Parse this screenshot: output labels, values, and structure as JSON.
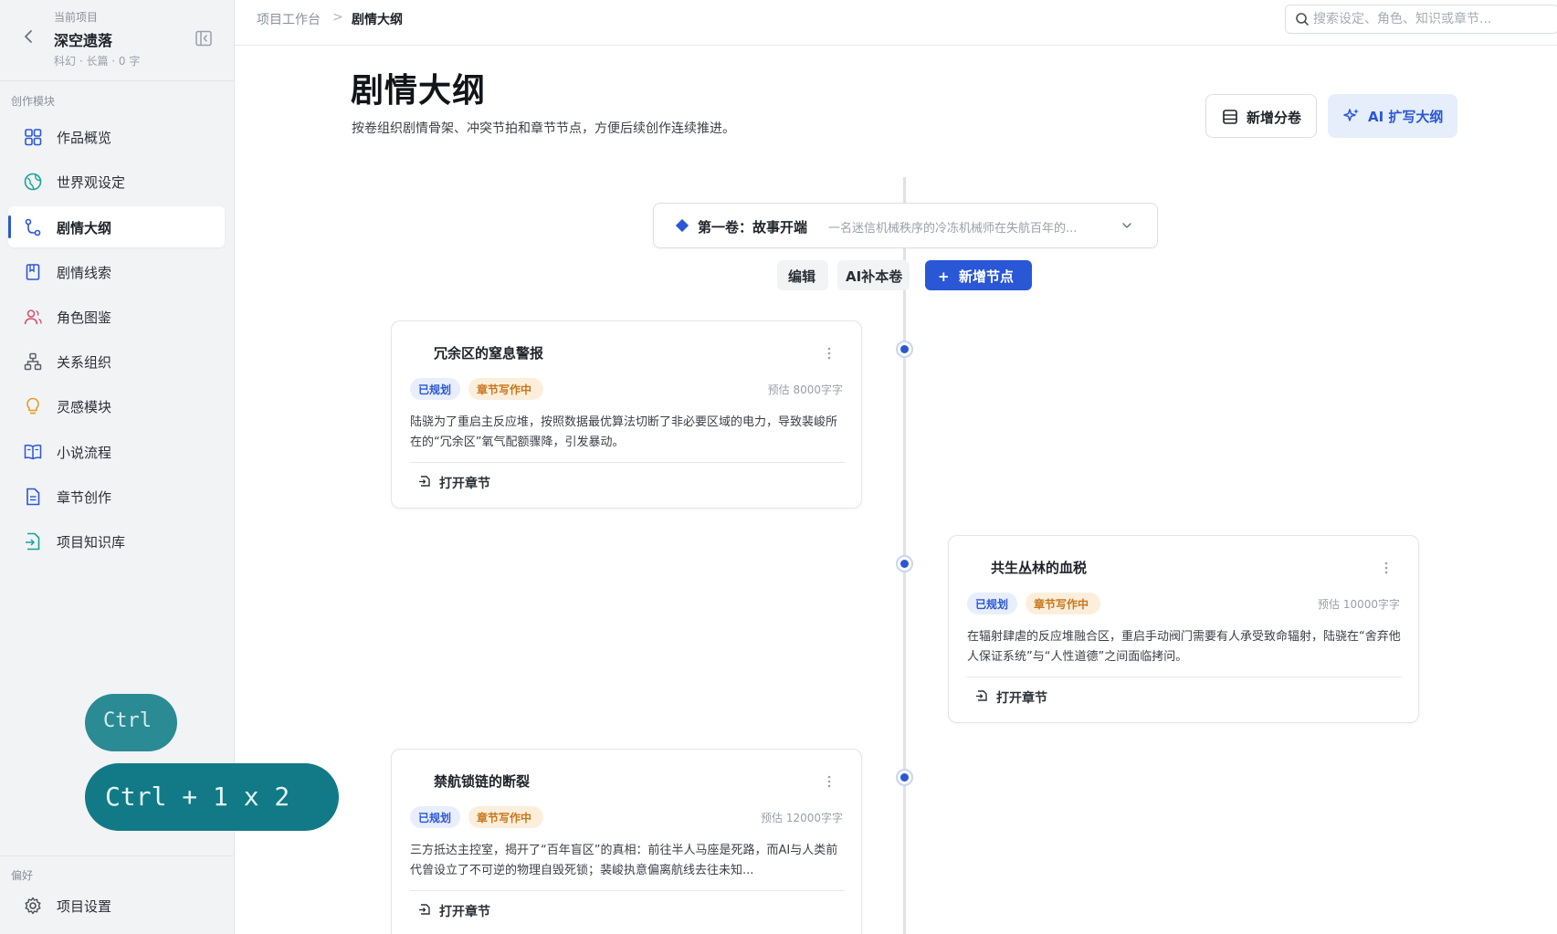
{
  "sidebar": {
    "project_caption": "当前项目",
    "project_name": "深空遗落",
    "project_meta": "科幻 · 长篇 · 0 字",
    "section_label": "创作模块",
    "items": [
      {
        "label": "作品概览",
        "icon": "grid-icon"
      },
      {
        "label": "世界观设定",
        "icon": "globe-icon"
      },
      {
        "label": "剧情大纲",
        "icon": "route-icon",
        "active": true
      },
      {
        "label": "剧情线索",
        "icon": "bookmark-icon"
      },
      {
        "label": "角色图鉴",
        "icon": "users-icon"
      },
      {
        "label": "关系组织",
        "icon": "org-icon"
      },
      {
        "label": "灵感模块",
        "icon": "lightbulb-icon"
      },
      {
        "label": "小说流程",
        "icon": "book-open-icon"
      },
      {
        "label": "章节创作",
        "icon": "document-icon"
      },
      {
        "label": "项目知识库",
        "icon": "file-sync-icon"
      }
    ],
    "pref_label": "偏好",
    "settings_label": "项目设置"
  },
  "header": {
    "breadcrumb_root": "项目工作台",
    "breadcrumb_sep": ">",
    "breadcrumb_current": "剧情大纲",
    "search_placeholder": "搜索设定、角色、知识或章节..."
  },
  "page": {
    "title": "剧情大纲",
    "subtitle": "按卷组织剧情骨架、冲突节拍和章节节点，方便后续创作连续推进。",
    "add_volume_label": "新增分卷",
    "ai_expand_label": "AI 扩写大纲"
  },
  "volume": {
    "title": "第一卷：故事开端",
    "description": "一名迷信机械秩序的冷冻机械师在失航百年的...",
    "edit_label": "编辑",
    "ai_fill_label": "AI补本卷",
    "add_node_label": "+  新增节点"
  },
  "nodes": [
    {
      "title": "冗余区的窒息警报",
      "tag_planned": "已规划",
      "tag_status": "章节写作中",
      "estimate": "预估 8000字字",
      "description": "陆骁为了重启主反应堆，按照数据最优算法切断了非必要区域的电力，导致裴峻所在的“冗余区”氧气配额骤降，引发暴动。",
      "open_label": "打开章节"
    },
    {
      "title": "共生丛林的血税",
      "tag_planned": "已规划",
      "tag_status": "章节写作中",
      "estimate": "预估 10000字字",
      "description": "在辐射肆虐的反应堆融合区，重启手动阀门需要有人承受致命辐射，陆骁在“舍弃他人保证系统”与“人性道德”之间面临拷问。",
      "open_label": "打开章节"
    },
    {
      "title": "禁航锁链的断裂",
      "tag_planned": "已规划",
      "tag_status": "章节写作中",
      "estimate": "预估 12000字字",
      "description": "三方抵达主控室，揭开了“百年盲区”的真相：前往半人马座是死路，而AI与人类前代曾设立了不可逆的物理自毁死锁；裴峻执意偏离航线去往未知...",
      "open_label": "打开章节"
    }
  ],
  "key_overlay": {
    "single": "Ctrl",
    "combo": "Ctrl + 1 x 2"
  },
  "colors": {
    "accent": "#2a57d5",
    "accent_soft": "#e6eefc",
    "tag_orange": "#c9761c",
    "key_teal": "#127a87"
  }
}
